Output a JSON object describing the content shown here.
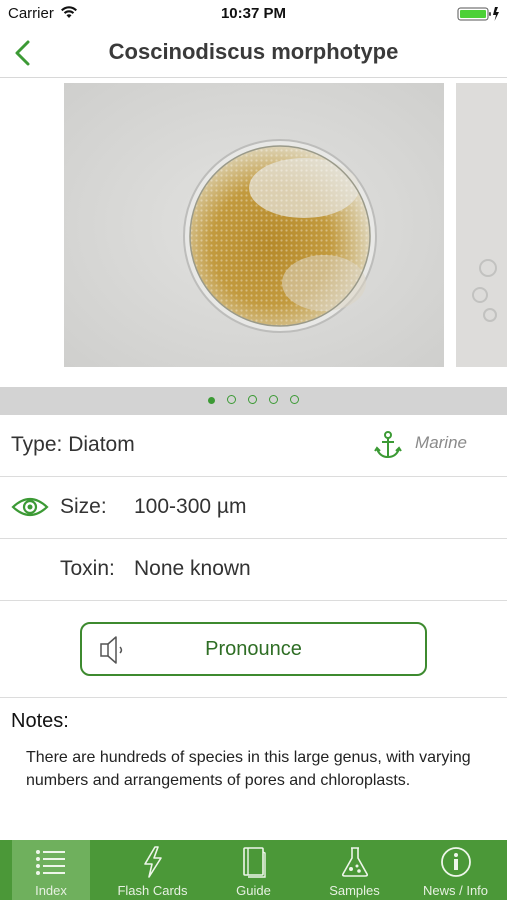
{
  "status_bar": {
    "carrier": "Carrier",
    "time": "10:37 PM"
  },
  "nav": {
    "title": "Coscinodiscus morphotype"
  },
  "gallery": {
    "page_count": 5,
    "active_page": 1
  },
  "details": {
    "type_label": "Type: Diatom",
    "habitat": "Marine",
    "size_label": "Size:",
    "size_value": "100-300 µm",
    "toxin_label": "Toxin:",
    "toxin_value": "None known"
  },
  "pronounce": {
    "label": "Pronounce"
  },
  "notes": {
    "title": "Notes:",
    "body": "There are hundreds of species in this large genus, with varying numbers and arrangements of pores and chloroplasts."
  },
  "tabs": [
    {
      "label": "Index",
      "icon": "list-icon",
      "active": true
    },
    {
      "label": "Flash Cards",
      "icon": "lightning-icon",
      "active": false
    },
    {
      "label": "Guide",
      "icon": "book-icon",
      "active": false
    },
    {
      "label": "Samples",
      "icon": "flask-icon",
      "active": false
    },
    {
      "label": "News / Info",
      "icon": "info-icon",
      "active": false
    }
  ],
  "colors": {
    "accent": "#3c9a35",
    "tab_bar": "#4b9838",
    "tab_active": "#6fb05d"
  }
}
